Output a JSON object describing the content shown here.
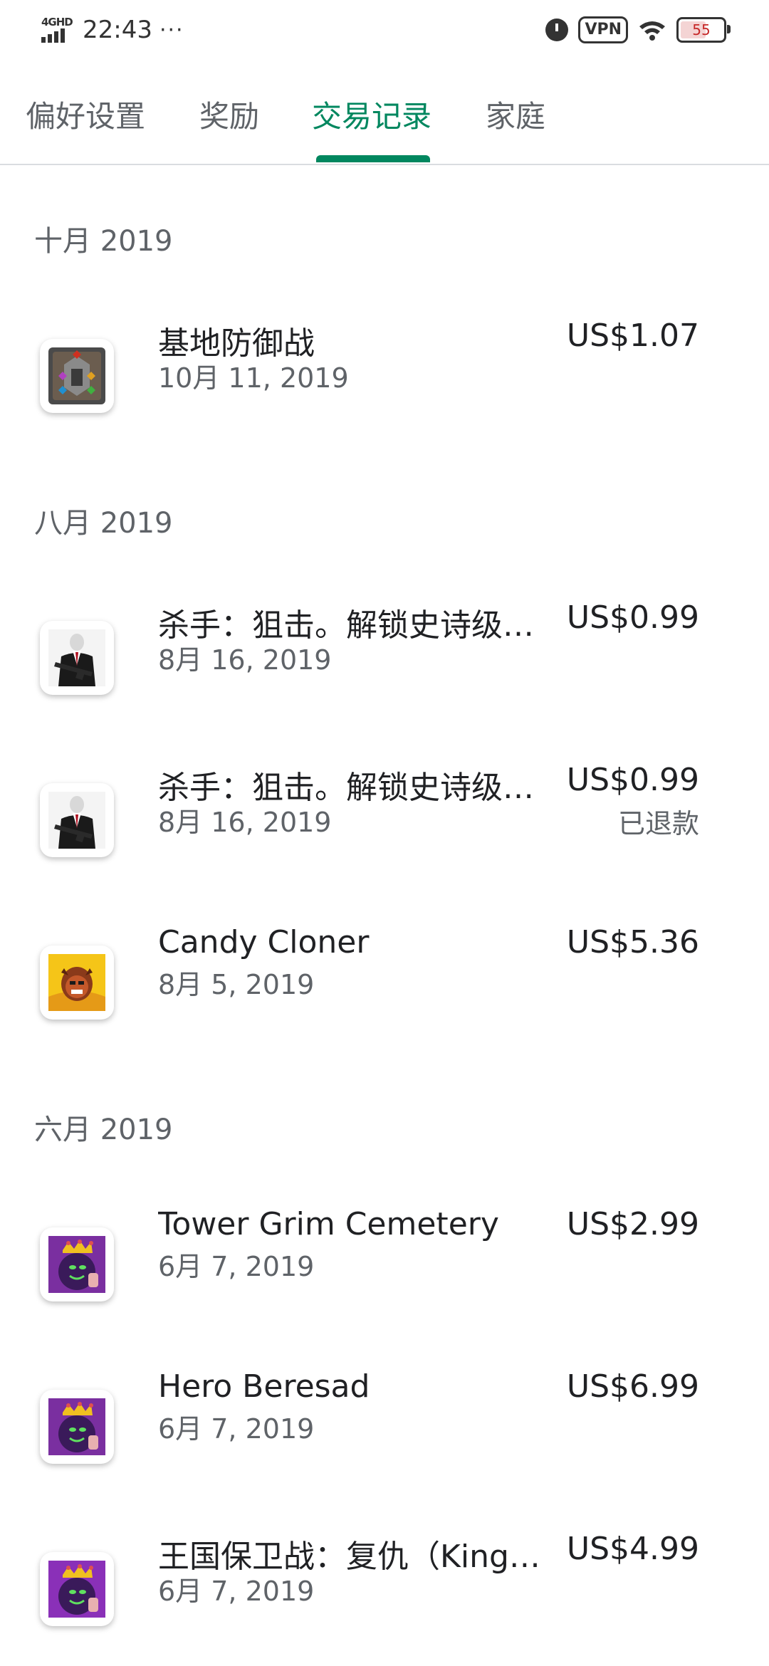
{
  "status_bar": {
    "network": "4GHD",
    "time": "22:43",
    "dots": "···",
    "vpn": "VPN",
    "battery": "55"
  },
  "tabs": [
    {
      "label": "偏好设置",
      "active": false
    },
    {
      "label": "奖励",
      "active": false
    },
    {
      "label": "交易记录",
      "active": true
    },
    {
      "label": "家庭",
      "active": false
    }
  ],
  "sections": [
    {
      "header": "十月 2019",
      "items": [
        {
          "title": "基地防御战",
          "date": "10月 11, 2019",
          "price": "US$1.07",
          "status": "",
          "icon": "fortress-game-icon"
        }
      ]
    },
    {
      "header": "八月 2019",
      "items": [
        {
          "title": "杀手：狙击。解锁史诗级…",
          "date": "8月 16, 2019",
          "price": "US$0.99",
          "status": "",
          "icon": "hitman-sniper-icon"
        },
        {
          "title": "杀手：狙击。解锁史诗级…",
          "date": "8月 16, 2019",
          "price": "US$0.99",
          "status": "已退款",
          "icon": "hitman-sniper-icon"
        },
        {
          "title": "Candy Cloner",
          "date": "8月 5, 2019",
          "price": "US$5.36",
          "status": "",
          "icon": "candy-cloner-icon"
        }
      ]
    },
    {
      "header": "六月 2019",
      "items": [
        {
          "title": "Tower Grim Cemetery",
          "date": "6月 7, 2019",
          "price": "US$2.99",
          "status": "",
          "icon": "kingdom-rush-icon"
        },
        {
          "title": "Hero Beresad",
          "date": "6月 7, 2019",
          "price": "US$6.99",
          "status": "",
          "icon": "kingdom-rush-icon"
        },
        {
          "title": "王国保卫战：复仇（King…",
          "date": "6月 7, 2019",
          "price": "US$4.99",
          "status": "",
          "icon": "kingdom-rush-icon"
        }
      ]
    }
  ],
  "colors": {
    "accent": "#01875f",
    "text_primary": "#202124",
    "text_secondary": "#5f6368"
  }
}
